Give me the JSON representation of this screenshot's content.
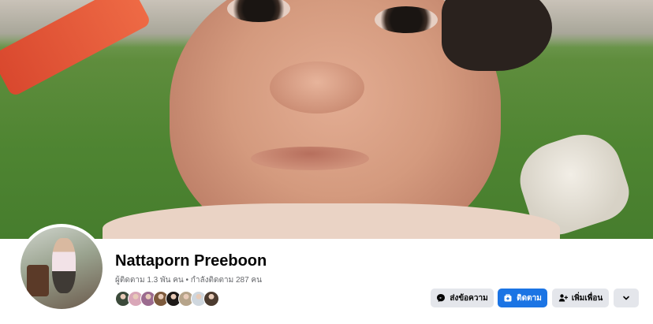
{
  "profile": {
    "name": "Nattaporn Preeboon",
    "stats": "ผู้ติดตาม 1.3 พัน คน • กำลังติดตาม 287 คน"
  },
  "friends_preview": [
    {
      "icon": "friend-avatar",
      "color": "#3b4a3a"
    },
    {
      "icon": "friend-avatar",
      "color": "#d9a7b8"
    },
    {
      "icon": "friend-avatar",
      "color": "#9b6b8f"
    },
    {
      "icon": "friend-avatar",
      "color": "#7d5a3c"
    },
    {
      "icon": "friend-avatar",
      "color": "#1e1a18"
    },
    {
      "icon": "friend-avatar",
      "color": "#b6a48a"
    },
    {
      "icon": "friend-avatar",
      "color": "#cfd7de"
    },
    {
      "icon": "friend-avatar",
      "color": "#4c3b2f"
    }
  ],
  "actions": {
    "message_label": "ส่งข้อความ",
    "follow_label": "ติดตาม",
    "add_friend_label": "เพิ่มเพื่อน"
  },
  "colors": {
    "primary": "#1b74e4",
    "secondary_button": "#e4e6eb",
    "text": "#050505",
    "muted_text": "#65676b"
  }
}
